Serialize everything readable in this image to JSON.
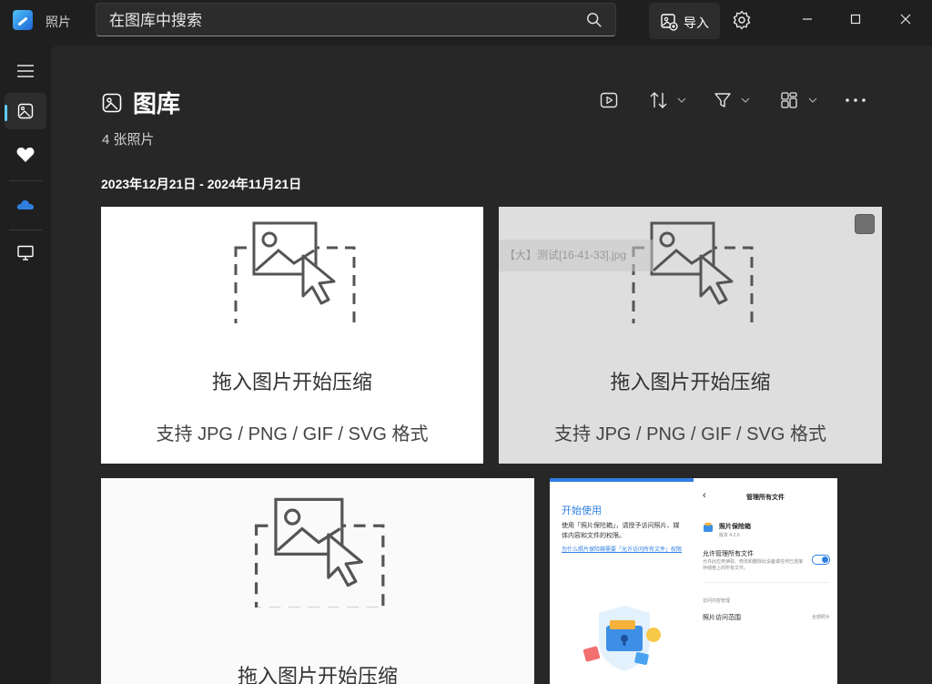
{
  "app": {
    "title": "照片"
  },
  "search": {
    "placeholder": "在图库中搜索"
  },
  "toolbar": {
    "import_label": "导入"
  },
  "page": {
    "title": "图库",
    "count": "4 张照片"
  },
  "section": {
    "date_range": "2023年12月21日 - 2024年11月21日"
  },
  "cards": [
    {
      "main": "拖入图片开始压缩",
      "sub": "支持 JPG / PNG / GIF / SVG 格式"
    },
    {
      "main": "拖入图片开始压缩",
      "sub": "支持 JPG / PNG / GIF / SVG 格式",
      "overlay": "【大】测试[16-41-33].jpg"
    },
    {
      "main": "拖入图片开始压缩"
    }
  ],
  "screenshot": {
    "left_heading": "开始使用",
    "left_text": "使用「照片保险箱」，请授予访问照片、媒体内容和文件的权限。",
    "left_link": "为什么照片保险箱需要「允许访问所有文件」权限",
    "right_title": "管理所有文件",
    "app_name": "照片保险箱",
    "app_version": "版本 4.2.0",
    "permission_label": "允许管理所有文件",
    "permission_desc": "允许此应用读取、修改和删除此设备或任何已连接存储卷上的所有文件。",
    "section_label": "访问内容管理",
    "row_label": "照片访问范围",
    "row_value": "全部照片"
  },
  "colors": {
    "accent": "#60cdff",
    "background": "#1f1f1f",
    "surface": "#272727"
  }
}
